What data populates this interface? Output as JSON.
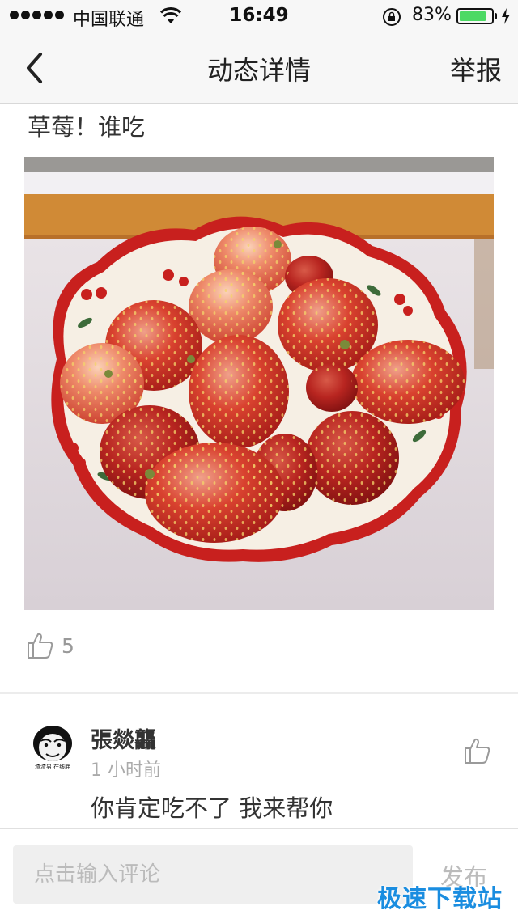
{
  "status_bar": {
    "carrier": "中国联通",
    "time": "16:49",
    "battery_percent": "83%",
    "battery_level": 0.83,
    "icons": [
      "signal-dots",
      "wifi-icon",
      "rotation-lock-icon",
      "battery-icon",
      "charging-icon"
    ]
  },
  "nav": {
    "back_icon": "chevron-left-icon",
    "title": "动态详情",
    "report_label": "举报"
  },
  "post": {
    "text": "草莓！谁吃",
    "image_subject": "bowl-of-strawberries",
    "like_icon": "thumbs-up-icon",
    "like_count": "5"
  },
  "comment": {
    "username": "張燚龘",
    "time": "1 小时前",
    "text": "你肯定吃不了 我来帮你",
    "avatar_caption": "渣渣男 在线胖",
    "like_icon": "thumbs-up-icon"
  },
  "bottom_bar": {
    "input_placeholder": "点击输入评论",
    "input_value": "",
    "publish_label": "发布"
  },
  "watermark": "极速下载站",
  "colors": {
    "bar_background": "#f7f7f7",
    "battery_green": "#4cd964",
    "watermark_blue": "#1a8de0",
    "muted_text": "#aaaaaa"
  }
}
